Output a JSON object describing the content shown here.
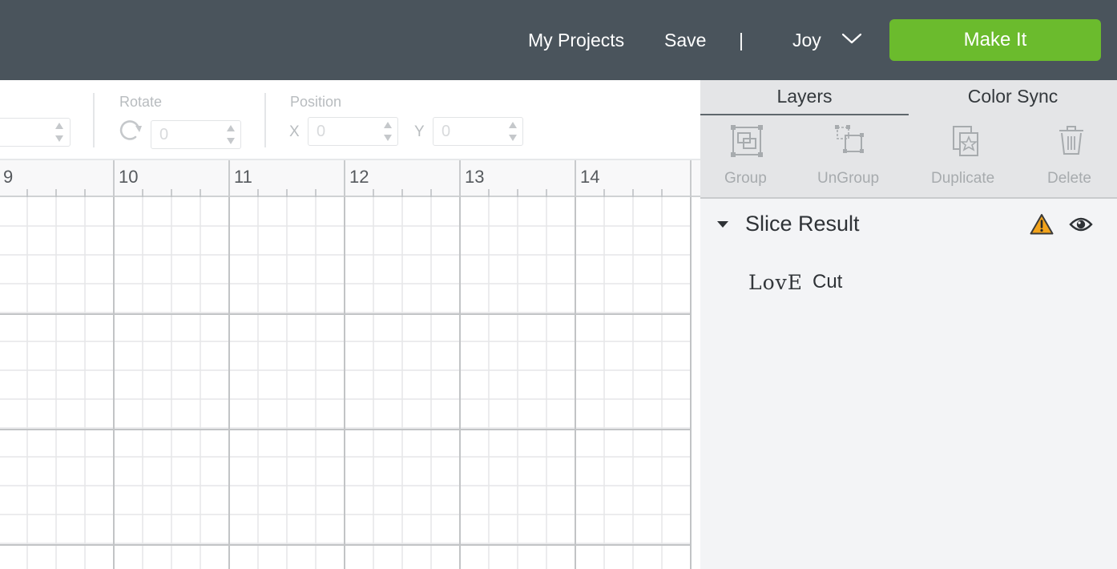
{
  "header": {
    "nav": {
      "my_projects": "My Projects",
      "save": "Save",
      "separator": "|",
      "user_name": "Joy"
    },
    "make_it_label": "Make It",
    "colors": {
      "bar": "#4a545c",
      "make_it": "#6bbb2d"
    }
  },
  "toolbar": {
    "size_value": "",
    "rotate": {
      "label": "Rotate",
      "value": "0",
      "icon": "rotate-icon"
    },
    "position": {
      "label": "Position",
      "x_label": "X",
      "x_value": "0",
      "y_label": "Y",
      "y_value": "0"
    }
  },
  "canvas": {
    "ruler_numbers": [
      "9",
      "10",
      "11",
      "12",
      "13",
      "14"
    ],
    "grid_lines_per_unit": 4
  },
  "panel": {
    "tabs": [
      {
        "label": "Layers",
        "active": true
      },
      {
        "label": "Color Sync",
        "active": false
      }
    ],
    "actions": [
      {
        "label": "Group",
        "icon": "group-icon"
      },
      {
        "label": "UnGroup",
        "icon": "ungroup-icon"
      },
      {
        "label": "Duplicate",
        "icon": "duplicate-icon"
      },
      {
        "label": "Delete",
        "icon": "trash-icon"
      }
    ],
    "layer_group": {
      "title": "Slice Result",
      "expanded": true,
      "status_icons": [
        "warning-icon",
        "eye-icon"
      ],
      "warning_color": "#f2a31b"
    },
    "layers": [
      {
        "thumbnail_text": "LovE",
        "name": "Cut"
      }
    ]
  }
}
